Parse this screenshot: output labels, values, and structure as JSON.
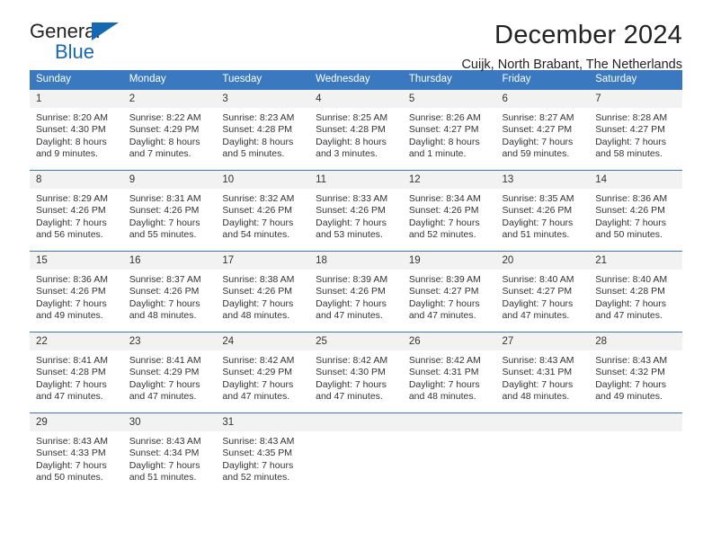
{
  "brand": {
    "name_top": "General",
    "name_bottom": "Blue",
    "triangle_color": "#1668b3"
  },
  "header": {
    "title": "December 2024",
    "subtitle": "Cuijk, North Brabant, The Netherlands"
  },
  "theme": {
    "header_blue": "#3a78bf",
    "daynum_bg": "#f2f2f2",
    "text": "#333333"
  },
  "weekday_headers": [
    "Sunday",
    "Monday",
    "Tuesday",
    "Wednesday",
    "Thursday",
    "Friday",
    "Saturday"
  ],
  "weeks": [
    [
      {
        "day": "1",
        "sunrise": "Sunrise: 8:20 AM",
        "sunset": "Sunset: 4:30 PM",
        "daylight1": "Daylight: 8 hours",
        "daylight2": "and 9 minutes."
      },
      {
        "day": "2",
        "sunrise": "Sunrise: 8:22 AM",
        "sunset": "Sunset: 4:29 PM",
        "daylight1": "Daylight: 8 hours",
        "daylight2": "and 7 minutes."
      },
      {
        "day": "3",
        "sunrise": "Sunrise: 8:23 AM",
        "sunset": "Sunset: 4:28 PM",
        "daylight1": "Daylight: 8 hours",
        "daylight2": "and 5 minutes."
      },
      {
        "day": "4",
        "sunrise": "Sunrise: 8:25 AM",
        "sunset": "Sunset: 4:28 PM",
        "daylight1": "Daylight: 8 hours",
        "daylight2": "and 3 minutes."
      },
      {
        "day": "5",
        "sunrise": "Sunrise: 8:26 AM",
        "sunset": "Sunset: 4:27 PM",
        "daylight1": "Daylight: 8 hours",
        "daylight2": "and 1 minute."
      },
      {
        "day": "6",
        "sunrise": "Sunrise: 8:27 AM",
        "sunset": "Sunset: 4:27 PM",
        "daylight1": "Daylight: 7 hours",
        "daylight2": "and 59 minutes."
      },
      {
        "day": "7",
        "sunrise": "Sunrise: 8:28 AM",
        "sunset": "Sunset: 4:27 PM",
        "daylight1": "Daylight: 7 hours",
        "daylight2": "and 58 minutes."
      }
    ],
    [
      {
        "day": "8",
        "sunrise": "Sunrise: 8:29 AM",
        "sunset": "Sunset: 4:26 PM",
        "daylight1": "Daylight: 7 hours",
        "daylight2": "and 56 minutes."
      },
      {
        "day": "9",
        "sunrise": "Sunrise: 8:31 AM",
        "sunset": "Sunset: 4:26 PM",
        "daylight1": "Daylight: 7 hours",
        "daylight2": "and 55 minutes."
      },
      {
        "day": "10",
        "sunrise": "Sunrise: 8:32 AM",
        "sunset": "Sunset: 4:26 PM",
        "daylight1": "Daylight: 7 hours",
        "daylight2": "and 54 minutes."
      },
      {
        "day": "11",
        "sunrise": "Sunrise: 8:33 AM",
        "sunset": "Sunset: 4:26 PM",
        "daylight1": "Daylight: 7 hours",
        "daylight2": "and 53 minutes."
      },
      {
        "day": "12",
        "sunrise": "Sunrise: 8:34 AM",
        "sunset": "Sunset: 4:26 PM",
        "daylight1": "Daylight: 7 hours",
        "daylight2": "and 52 minutes."
      },
      {
        "day": "13",
        "sunrise": "Sunrise: 8:35 AM",
        "sunset": "Sunset: 4:26 PM",
        "daylight1": "Daylight: 7 hours",
        "daylight2": "and 51 minutes."
      },
      {
        "day": "14",
        "sunrise": "Sunrise: 8:36 AM",
        "sunset": "Sunset: 4:26 PM",
        "daylight1": "Daylight: 7 hours",
        "daylight2": "and 50 minutes."
      }
    ],
    [
      {
        "day": "15",
        "sunrise": "Sunrise: 8:36 AM",
        "sunset": "Sunset: 4:26 PM",
        "daylight1": "Daylight: 7 hours",
        "daylight2": "and 49 minutes."
      },
      {
        "day": "16",
        "sunrise": "Sunrise: 8:37 AM",
        "sunset": "Sunset: 4:26 PM",
        "daylight1": "Daylight: 7 hours",
        "daylight2": "and 48 minutes."
      },
      {
        "day": "17",
        "sunrise": "Sunrise: 8:38 AM",
        "sunset": "Sunset: 4:26 PM",
        "daylight1": "Daylight: 7 hours",
        "daylight2": "and 48 minutes."
      },
      {
        "day": "18",
        "sunrise": "Sunrise: 8:39 AM",
        "sunset": "Sunset: 4:26 PM",
        "daylight1": "Daylight: 7 hours",
        "daylight2": "and 47 minutes."
      },
      {
        "day": "19",
        "sunrise": "Sunrise: 8:39 AM",
        "sunset": "Sunset: 4:27 PM",
        "daylight1": "Daylight: 7 hours",
        "daylight2": "and 47 minutes."
      },
      {
        "day": "20",
        "sunrise": "Sunrise: 8:40 AM",
        "sunset": "Sunset: 4:27 PM",
        "daylight1": "Daylight: 7 hours",
        "daylight2": "and 47 minutes."
      },
      {
        "day": "21",
        "sunrise": "Sunrise: 8:40 AM",
        "sunset": "Sunset: 4:28 PM",
        "daylight1": "Daylight: 7 hours",
        "daylight2": "and 47 minutes."
      }
    ],
    [
      {
        "day": "22",
        "sunrise": "Sunrise: 8:41 AM",
        "sunset": "Sunset: 4:28 PM",
        "daylight1": "Daylight: 7 hours",
        "daylight2": "and 47 minutes."
      },
      {
        "day": "23",
        "sunrise": "Sunrise: 8:41 AM",
        "sunset": "Sunset: 4:29 PM",
        "daylight1": "Daylight: 7 hours",
        "daylight2": "and 47 minutes."
      },
      {
        "day": "24",
        "sunrise": "Sunrise: 8:42 AM",
        "sunset": "Sunset: 4:29 PM",
        "daylight1": "Daylight: 7 hours",
        "daylight2": "and 47 minutes."
      },
      {
        "day": "25",
        "sunrise": "Sunrise: 8:42 AM",
        "sunset": "Sunset: 4:30 PM",
        "daylight1": "Daylight: 7 hours",
        "daylight2": "and 47 minutes."
      },
      {
        "day": "26",
        "sunrise": "Sunrise: 8:42 AM",
        "sunset": "Sunset: 4:31 PM",
        "daylight1": "Daylight: 7 hours",
        "daylight2": "and 48 minutes."
      },
      {
        "day": "27",
        "sunrise": "Sunrise: 8:43 AM",
        "sunset": "Sunset: 4:31 PM",
        "daylight1": "Daylight: 7 hours",
        "daylight2": "and 48 minutes."
      },
      {
        "day": "28",
        "sunrise": "Sunrise: 8:43 AM",
        "sunset": "Sunset: 4:32 PM",
        "daylight1": "Daylight: 7 hours",
        "daylight2": "and 49 minutes."
      }
    ],
    [
      {
        "day": "29",
        "sunrise": "Sunrise: 8:43 AM",
        "sunset": "Sunset: 4:33 PM",
        "daylight1": "Daylight: 7 hours",
        "daylight2": "and 50 minutes."
      },
      {
        "day": "30",
        "sunrise": "Sunrise: 8:43 AM",
        "sunset": "Sunset: 4:34 PM",
        "daylight1": "Daylight: 7 hours",
        "daylight2": "and 51 minutes."
      },
      {
        "day": "31",
        "sunrise": "Sunrise: 8:43 AM",
        "sunset": "Sunset: 4:35 PM",
        "daylight1": "Daylight: 7 hours",
        "daylight2": "and 52 minutes."
      },
      {
        "day": "",
        "sunrise": "",
        "sunset": "",
        "daylight1": "",
        "daylight2": ""
      },
      {
        "day": "",
        "sunrise": "",
        "sunset": "",
        "daylight1": "",
        "daylight2": ""
      },
      {
        "day": "",
        "sunrise": "",
        "sunset": "",
        "daylight1": "",
        "daylight2": ""
      },
      {
        "day": "",
        "sunrise": "",
        "sunset": "",
        "daylight1": "",
        "daylight2": ""
      }
    ]
  ]
}
